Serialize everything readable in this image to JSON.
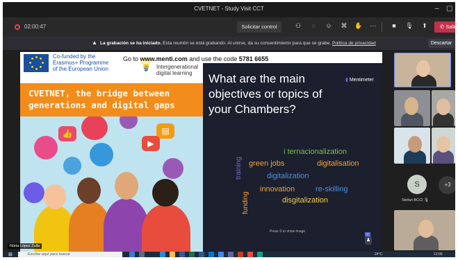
{
  "window": {
    "title": "CVETNET - Study Visit CCT"
  },
  "toolbar": {
    "timer": "02:00:47",
    "request_control": "Solicitar control",
    "leave": "Salir"
  },
  "banner": {
    "bold": "La grabación se ha iniciado.",
    "text": "Esta reunión se está grabando. Al unirse, da su consentimiento para que se grabe.",
    "link": "Política de privacidad",
    "dismiss": "Descartar"
  },
  "leaflet": {
    "cofund_line1": "Co-funded by the",
    "cofund_line2": "Erasmus+ Programme",
    "cofund_line3": "of the European Union",
    "inter_line1": "Intergenerational",
    "inter_line2": "digital learning",
    "headline": "CVETNET, the bridge between generations and digital gaps"
  },
  "menti": {
    "banner_pre": "Go to ",
    "banner_url": "www.menti.com",
    "banner_mid": " and use the code ",
    "banner_code": "5781 6655",
    "question": "What are the main objectives or topics of your Chambers?",
    "logo": "Mentimeter",
    "words": {
      "w1": "i ternacionalization",
      "w2": "green jobs",
      "w3": "digitalisation",
      "w4": "digitalization",
      "w5": "innovation",
      "w6": "re-skilling",
      "w7": "disgitalization",
      "w8": "training",
      "w9": "funding"
    },
    "hint": "Press S to show image",
    "page_badge": "1"
  },
  "presenter": "Núria López Zulla",
  "participants": {
    "avatar_initial": "S",
    "avatar_name": "Stefan BCCI",
    "more": "+3"
  },
  "taskbar": {
    "search_placeholder": "Escribe aquí para buscar",
    "temperature": "24°C",
    "time": "12:00"
  },
  "colors": {
    "accent_orange": "#f28c1a",
    "leave_red": "#c4314b",
    "slide_bg": "#1c1f2e",
    "word_green": "#7bc043",
    "word_orange": "#f2a33a",
    "word_blue": "#4a90e2",
    "word_yellow": "#f4d03f"
  }
}
